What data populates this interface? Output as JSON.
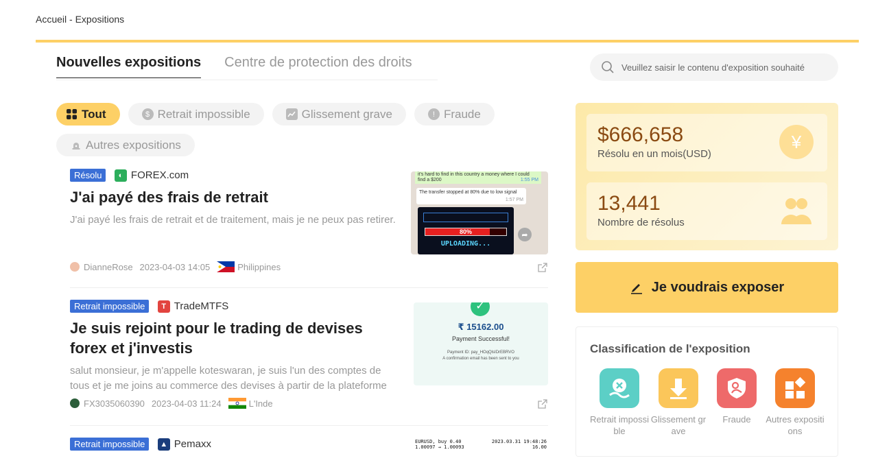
{
  "breadcrumb": "Accueil - Expositions",
  "tabs": [
    {
      "label": "Nouvelles expositions",
      "active": true
    },
    {
      "label": "Centre de protection des droits",
      "active": false
    }
  ],
  "search": {
    "placeholder": "Veuillez saisir le contenu d'exposition souhaité"
  },
  "filters": [
    {
      "label": "Tout",
      "active": true,
      "icon": "grid-icon"
    },
    {
      "label": "Retrait impossible",
      "active": false,
      "icon": "dollar-icon"
    },
    {
      "label": "Glissement grave",
      "active": false,
      "icon": "chart-icon"
    },
    {
      "label": "Fraude",
      "active": false,
      "icon": "alert-icon"
    },
    {
      "label": "Autres expositions",
      "active": false,
      "icon": "bell-icon"
    }
  ],
  "posts": [
    {
      "badge": "Résolu",
      "broker": "FOREX.com",
      "title": "J'ai payé des frais de retrait",
      "desc": "J'ai payé les frais de retrait et de traitement, mais je ne peux pas retirer.",
      "user": "DianneRose",
      "date": "2023-04-03 14:05",
      "country": "Philippines",
      "thumb": {
        "msg1": "it's hard to find in this country a money where I could find a $200",
        "time1": "1:55 PM",
        "msg2": "The transfer stopped at 80% due to low signal",
        "time2": "1:57 PM",
        "progress_text": "80%",
        "loading": "UPLOADING...",
        "progress": 0.8
      }
    },
    {
      "badge": "Retrait impossible",
      "broker": "TradeMTFS",
      "title": "Je suis rejoint pour le trading de devises forex et j'investis",
      "desc": "salut monsieur, je m'appelle koteswaran, je suis l'un des comptes de tous et je me joins au commerce des devises à partir de la plateforme c...",
      "user": "FX3035060390",
      "date": "2023-04-03 11:24",
      "country": "L'Inde",
      "thumb": {
        "amount": "₹ 15162.00",
        "status": "Payment Successful!",
        "payment_id": "Payment ID: pay_HOqQlsIDrEBRVO",
        "note": "A confirmation email has been sent to you"
      }
    },
    {
      "badge": "Retrait impossible",
      "broker": "Pemaxx",
      "thumb": {
        "pair": "EURUSD, buy 0.40",
        "prices": "1.00097 → 1.00093",
        "ts": "2023.03.31 19:48:26",
        "val": "16.00"
      }
    }
  ],
  "stats": [
    {
      "value": "$666,658",
      "label": "Résolu en un mois(USD)",
      "icon": "yen-icon"
    },
    {
      "value": "13,441",
      "label": "Nombre de résolus",
      "icon": "users-icon"
    }
  ],
  "expose_button": "Je voudrais exposer",
  "classification": {
    "title": "Classification de l'exposition",
    "items": [
      {
        "label": "Retrait impossible",
        "color": "#5ccfc6",
        "icon": "withdraw-icon"
      },
      {
        "label": "Glissement grave",
        "color": "#fbc65a",
        "icon": "slip-icon"
      },
      {
        "label": "Fraude",
        "color": "#ee6a6a",
        "icon": "fraud-icon"
      },
      {
        "label": "Autres expositions",
        "color": "#f5822d",
        "icon": "other-icon"
      }
    ]
  },
  "colors": {
    "accent": "#fdd066",
    "badge": "#3b6fd6",
    "stat_value": "#8a4a12"
  }
}
